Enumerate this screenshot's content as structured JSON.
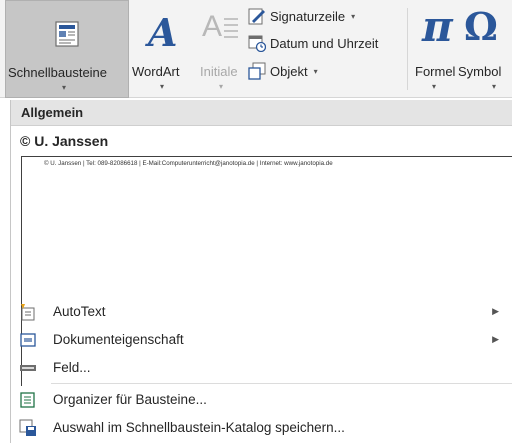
{
  "ribbon": {
    "schnellbausteine": "Schnellbausteine",
    "wordart": "WordArt",
    "initiale": "Initiale",
    "signaturzeile": "Signaturzeile",
    "datum_uhrzeit": "Datum und Uhrzeit",
    "objekt": "Objekt",
    "formel": "Formel",
    "symbol": "Symbol",
    "dropdown_glyph": "▾",
    "pi_glyph": "π",
    "omega_glyph": "Ω",
    "wordart_glyph": "A",
    "initiale_glyph": "A"
  },
  "panel": {
    "section_title": "Allgemein",
    "entry_title": "© U. Janssen",
    "preview_text": "© U. Janssen | Tel: 089-82086618 | E-Mail:Computerunterricht@janotopia.de | Internet: www.janotopia.de"
  },
  "menu": {
    "items": [
      {
        "label": "AutoText",
        "icon": "autotext-icon",
        "submenu": true
      },
      {
        "label": "Dokumenteigenschaft",
        "icon": "document-property-icon",
        "submenu": true
      },
      {
        "label": "Feld...",
        "icon": "field-icon",
        "submenu": false
      },
      {
        "label": "Organizer für Bausteine...",
        "icon": "building-blocks-organizer-icon",
        "submenu": false
      },
      {
        "label": "Auswahl im Schnellbaustein-Katalog speichern...",
        "icon": "save-selection-icon",
        "submenu": false
      }
    ],
    "submenu_arrow": "▶"
  },
  "colors": {
    "accent_blue": "#2b579a",
    "selected_button": "#c6c6c6",
    "ribbon_bg": "#f3f3f3",
    "section_header": "#e4e4e4"
  }
}
